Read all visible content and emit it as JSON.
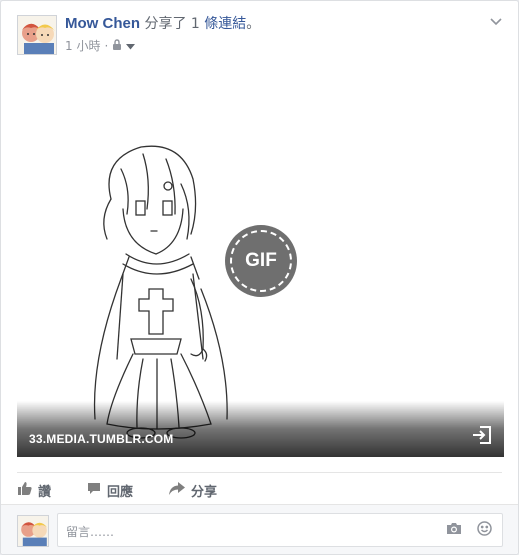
{
  "post": {
    "author": "Mow Chen",
    "action_prefix": " 分享了 ",
    "count": "1",
    "link_word": " 條連結",
    "action_suffix": "。",
    "time": "1 小時",
    "dot": "·"
  },
  "media": {
    "gif_label": "GIF",
    "domain": "33.MEDIA.TUMBLR.COM"
  },
  "actions": {
    "like": "讚",
    "comment": "回應",
    "share": "分享"
  },
  "comment": {
    "placeholder": "留言……"
  },
  "colors": {
    "author": "#365899",
    "muted": "#90949c",
    "action": "#616770"
  },
  "icons": [
    "lock-icon",
    "caret-down-icon",
    "chevron-down-icon",
    "open-external-icon",
    "like-icon",
    "comment-icon",
    "share-icon",
    "camera-icon",
    "smile-icon"
  ]
}
